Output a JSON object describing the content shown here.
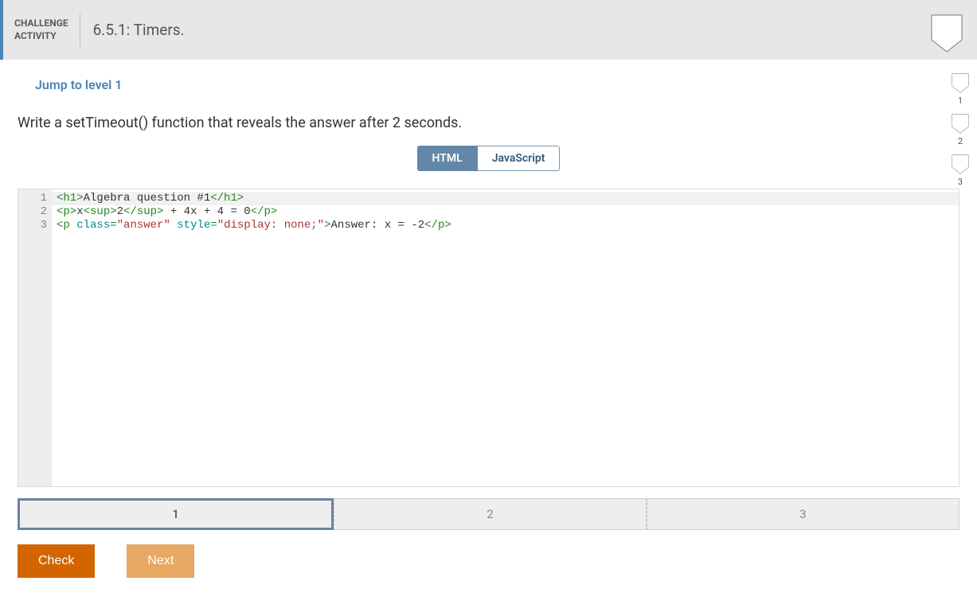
{
  "header": {
    "label_line1": "CHALLENGE",
    "label_line2": "ACTIVITY",
    "title": "6.5.1: Timers."
  },
  "jump_link": "Jump to level 1",
  "instruction": "Write a setTimeout() function that reveals the answer after 2 seconds.",
  "tabs": {
    "html": "HTML",
    "js": "JavaScript",
    "active": "html"
  },
  "code": {
    "lines": [
      [
        {
          "t": "tag",
          "v": "<h1>"
        },
        {
          "t": "txt",
          "v": "Algebra question #1"
        },
        {
          "t": "tag",
          "v": "</h1>"
        }
      ],
      [
        {
          "t": "tag",
          "v": "<p>"
        },
        {
          "t": "txt",
          "v": "x"
        },
        {
          "t": "tag",
          "v": "<sup>"
        },
        {
          "t": "txt",
          "v": "2"
        },
        {
          "t": "tag",
          "v": "</sup>"
        },
        {
          "t": "txt",
          "v": " + 4x + 4 = 0"
        },
        {
          "t": "tag",
          "v": "</p>"
        }
      ],
      [
        {
          "t": "tag",
          "v": "<p "
        },
        {
          "t": "attr",
          "v": "class"
        },
        {
          "t": "tag",
          "v": "="
        },
        {
          "t": "str",
          "v": "\"answer\""
        },
        {
          "t": "tag",
          "v": " "
        },
        {
          "t": "attr",
          "v": "style"
        },
        {
          "t": "tag",
          "v": "="
        },
        {
          "t": "str",
          "v": "\"display: none;\""
        },
        {
          "t": "tag",
          "v": ">"
        },
        {
          "t": "txt",
          "v": "Answer: x = -2"
        },
        {
          "t": "tag",
          "v": "</p>"
        }
      ]
    ]
  },
  "steps": [
    "1",
    "2",
    "3"
  ],
  "active_step": 0,
  "buttons": {
    "check": "Check",
    "next": "Next"
  },
  "right_levels": [
    "1",
    "2",
    "3"
  ]
}
